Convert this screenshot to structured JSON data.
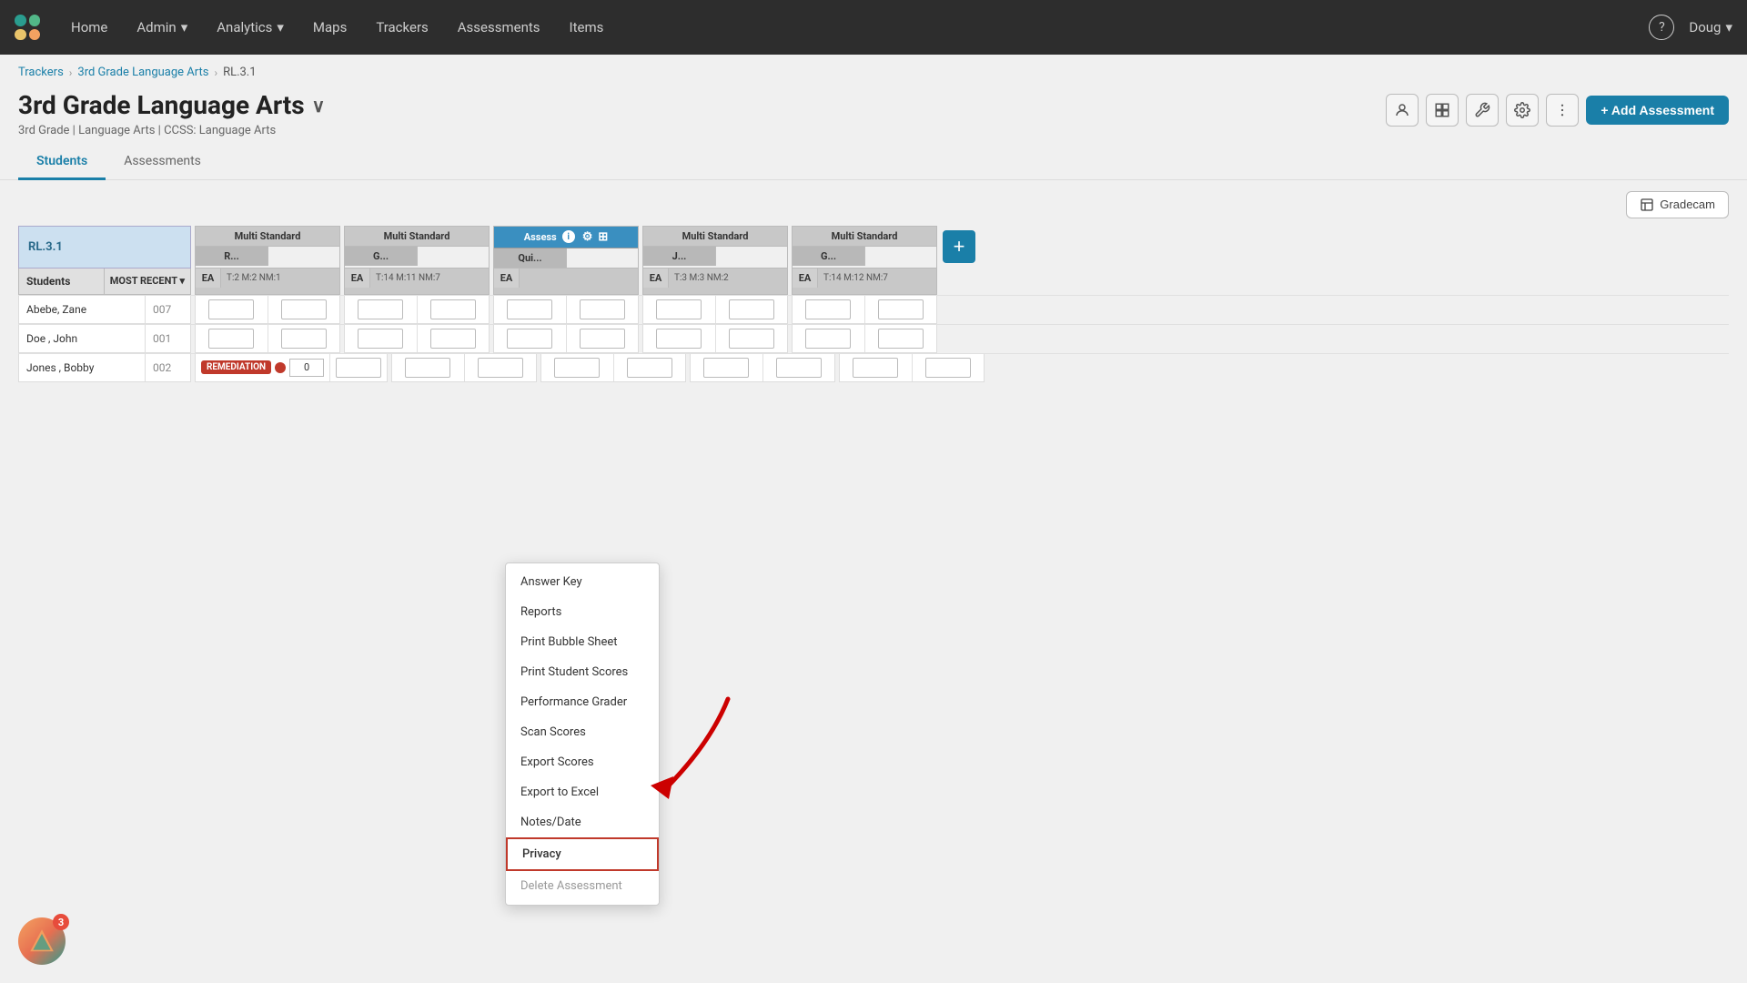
{
  "nav": {
    "home": "Home",
    "admin": "Admin",
    "analytics": "Analytics",
    "maps": "Maps",
    "trackers": "Trackers",
    "assessments": "Assessments",
    "items": "Items",
    "user": "Doug",
    "help_label": "?"
  },
  "breadcrumb": {
    "trackers": "Trackers",
    "subject": "3rd Grade Language Arts",
    "standard": "RL.3.1"
  },
  "page": {
    "title": "3rd Grade Language Arts",
    "subtitle": "3rd Grade  |  Language Arts  |  CCSS: Language Arts",
    "add_assessment": "+ Add Assessment",
    "gradecam": "Gradecam"
  },
  "tabs": {
    "students": "Students",
    "assessments": "Assessments"
  },
  "table": {
    "rl_label": "RL.3.1",
    "students_header": "Students",
    "most_recent": "MOST RECENT ▾",
    "col_groups": [
      {
        "label": "Multi Standard",
        "short": "R...",
        "subs": [
          "EA",
          "T:2  M:2  NM:1"
        ],
        "cols": [
          "",
          ""
        ]
      },
      {
        "label": "Multi Standard",
        "short": "G...",
        "subs": [
          "EA",
          "T:14  M:11  NM:7"
        ],
        "cols": [
          "",
          ""
        ]
      },
      {
        "label": "Assess",
        "short": "Qui...",
        "subs": [
          "EA",
          ""
        ],
        "cols": [
          "",
          ""
        ],
        "type": "assess"
      },
      {
        "label": "Multi Standard",
        "short": "J...",
        "subs": [
          "EA",
          "T:3  M:3  NM:2"
        ],
        "cols": [
          "",
          ""
        ]
      },
      {
        "label": "Multi Standard",
        "short": "G...",
        "subs": [
          "EA",
          "T:14  M:12  NM:7"
        ],
        "cols": [
          "",
          ""
        ]
      }
    ],
    "students": [
      {
        "name": "Abebe, Zane",
        "id": "007",
        "remediation": false,
        "red_dot": false,
        "score": ""
      },
      {
        "name": "Doe , John",
        "id": "001",
        "remediation": false,
        "red_dot": false,
        "score": ""
      },
      {
        "name": "Jones , Bobby",
        "id": "002",
        "remediation": true,
        "red_dot": true,
        "score": "0"
      }
    ]
  },
  "dropdown": {
    "items": [
      {
        "label": "Answer Key",
        "id": "answer-key"
      },
      {
        "label": "Reports",
        "id": "reports"
      },
      {
        "label": "Print Bubble Sheet",
        "id": "print-bubble"
      },
      {
        "label": "Print Student Scores",
        "id": "print-scores"
      },
      {
        "label": "Performance Grader",
        "id": "perf-grader"
      },
      {
        "label": "Scan Scores",
        "id": "scan-scores"
      },
      {
        "label": "Export Scores",
        "id": "export-scores"
      },
      {
        "label": "Export to Excel",
        "id": "export-excel"
      },
      {
        "label": "Notes/Date",
        "id": "notes-date"
      },
      {
        "label": "Privacy",
        "id": "privacy",
        "highlighted": true
      },
      {
        "label": "Delete Assessment",
        "id": "delete",
        "muted": true
      }
    ]
  },
  "badge": {
    "count": "3"
  }
}
